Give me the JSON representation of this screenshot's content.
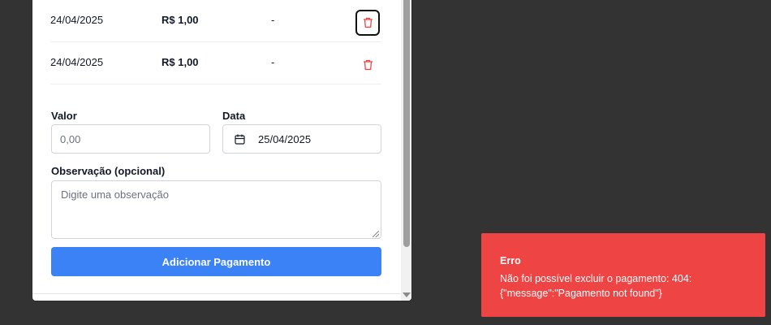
{
  "payments": [
    {
      "date": "24/04/2025",
      "amount": "R$ 1,00",
      "note": "-"
    },
    {
      "date": "24/04/2025",
      "amount": "R$ 1,00",
      "note": "-"
    }
  ],
  "form": {
    "value_label": "Valor",
    "value_placeholder": "0,00",
    "date_label": "Data",
    "date_value": "25/04/2025",
    "note_label": "Observação (opcional)",
    "note_placeholder": "Digite uma observação",
    "submit_label": "Adicionar Pagamento"
  },
  "toast": {
    "title": "Erro",
    "message": "Não foi possível excluir o pagamento: 404: {\"message\":\"Pagamento not found\"}"
  },
  "icons": {
    "delete": "trash-icon",
    "date": "calendar-icon"
  },
  "colors": {
    "primary": "#3b82f6",
    "danger": "#ef4444",
    "backdrop": "#333333"
  }
}
